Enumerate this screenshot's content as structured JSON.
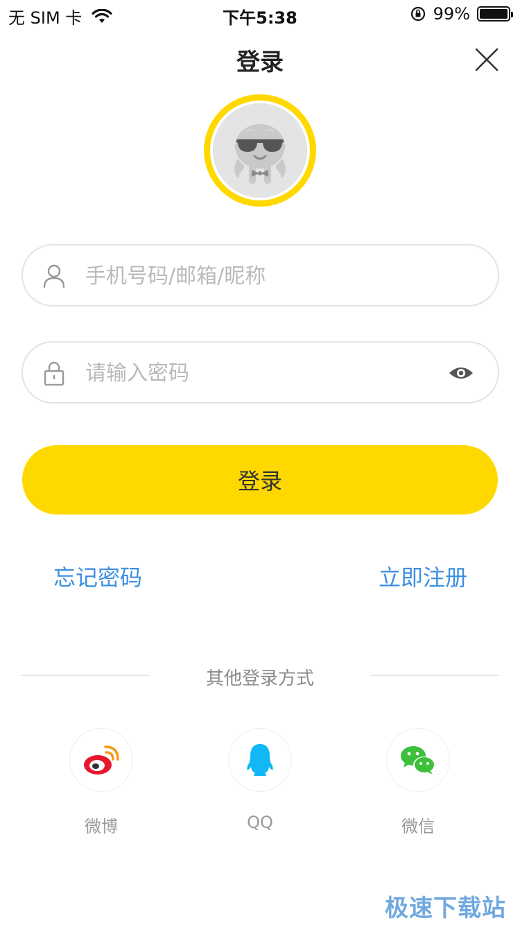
{
  "status_bar": {
    "carrier": "无 SIM 卡",
    "time": "下午5:38",
    "battery_text": "99%",
    "battery_level": 0.99
  },
  "header": {
    "title": "登录"
  },
  "form": {
    "account_placeholder": "手机号码/邮箱/昵称",
    "password_placeholder": "请输入密码",
    "login_label": "登录"
  },
  "links": {
    "forgot": "忘记密码",
    "register": "立即注册"
  },
  "other_login": {
    "title": "其他登录方式",
    "options": [
      {
        "label": "微博",
        "icon": "weibo-icon",
        "color": "#e6162d"
      },
      {
        "label": "QQ",
        "icon": "qq-icon",
        "color": "#12b7f5"
      },
      {
        "label": "微信",
        "icon": "wechat-icon",
        "color": "#3dc13c"
      }
    ]
  },
  "watermark": "极速下载站",
  "colors": {
    "accent": "#ffd800",
    "link": "#3d8fe0"
  }
}
